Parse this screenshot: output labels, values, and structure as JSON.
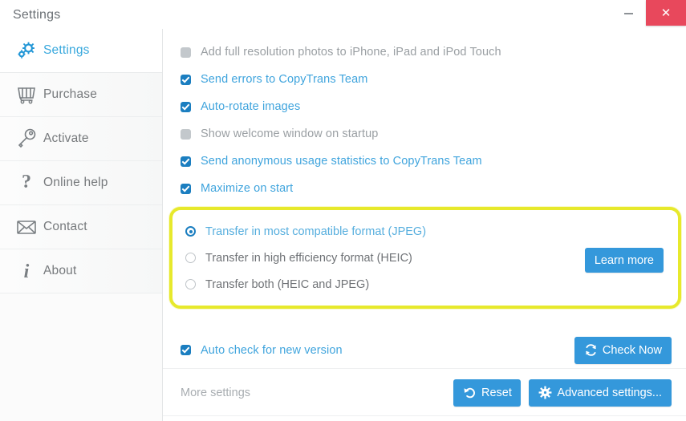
{
  "window": {
    "title": "Settings",
    "minimize_label": "–",
    "close_label": "✕",
    "close_color": "#e8485c",
    "accent_color": "#3498db",
    "highlight_color": "#e7e92c"
  },
  "sidebar": {
    "items": [
      {
        "label": "Settings",
        "icon": "gears-icon",
        "active": true
      },
      {
        "label": "Purchase",
        "icon": "shopping-cart-icon",
        "active": false
      },
      {
        "label": "Activate",
        "icon": "key-icon",
        "active": false
      },
      {
        "label": "Online help",
        "icon": "question-mark-icon",
        "active": false
      },
      {
        "label": "Contact",
        "icon": "envelope-icon",
        "active": false
      },
      {
        "label": "About",
        "icon": "info-icon",
        "active": false
      }
    ]
  },
  "main": {
    "checkboxes": [
      {
        "label": "Add full resolution photos to iPhone, iPad and iPod Touch",
        "checked": false
      },
      {
        "label": "Send errors to CopyTrans Team",
        "checked": true
      },
      {
        "label": "Auto-rotate images",
        "checked": true
      },
      {
        "label": "Show welcome window on startup",
        "checked": false
      },
      {
        "label": "Send anonymous usage statistics to CopyTrans Team",
        "checked": true
      },
      {
        "label": "Maximize on start",
        "checked": true
      }
    ],
    "transfer_format": {
      "options": [
        {
          "label": "Transfer in most compatible format (JPEG)",
          "selected": true
        },
        {
          "label": "Transfer in high efficiency format (HEIC)",
          "selected": false
        },
        {
          "label": "Transfer both (HEIC and JPEG)",
          "selected": false
        }
      ],
      "learn_more_label": "Learn more"
    },
    "auto_check": {
      "label": "Auto check for new version",
      "checked": true,
      "check_now_label": "Check Now",
      "check_now_icon": "refresh-icon"
    },
    "more_settings": {
      "label": "More settings",
      "reset_label": "Reset",
      "reset_icon": "undo-arrow-icon",
      "advanced_label": "Advanced settings...",
      "advanced_icon": "gear-icon"
    }
  }
}
